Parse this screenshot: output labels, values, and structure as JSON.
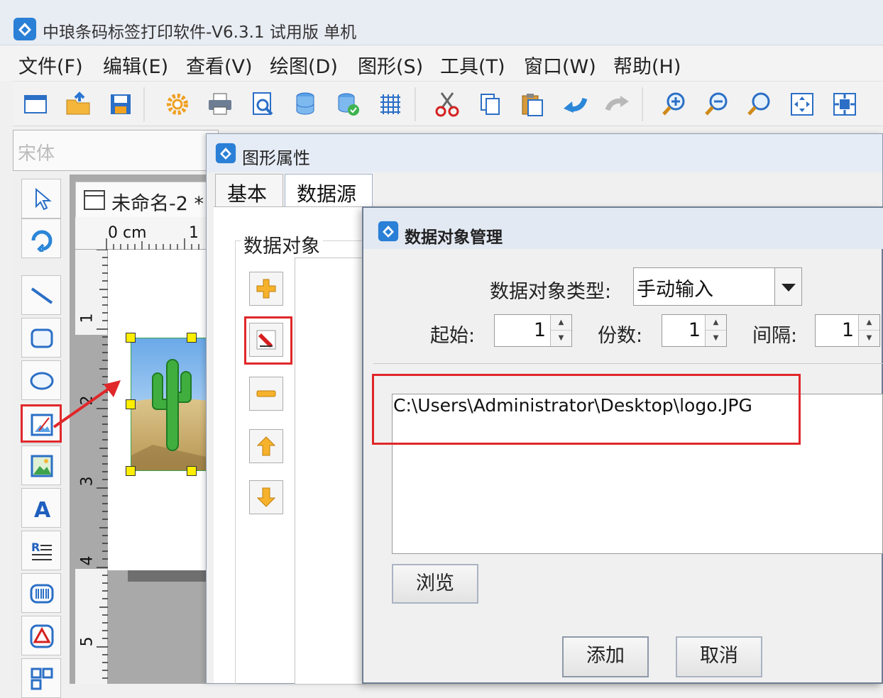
{
  "window": {
    "title": "中琅条码标签打印软件-V6.3.1 试用版 单机"
  },
  "menu": [
    {
      "label": "文件(F)"
    },
    {
      "label": "编辑(E)"
    },
    {
      "label": "查看(V)"
    },
    {
      "label": "绘图(D)"
    },
    {
      "label": "图形(S)"
    },
    {
      "label": "工具(T)"
    },
    {
      "label": "窗口(W)"
    },
    {
      "label": "帮助(H)"
    }
  ],
  "toolbar": {
    "icons": [
      "new-icon",
      "open-icon",
      "save-icon",
      "settings-icon",
      "print-icon",
      "print-preview-icon",
      "database-icon",
      "database-settings-icon",
      "grid-icon",
      "cut-icon",
      "copy-icon",
      "paste-icon",
      "undo-icon",
      "redo-icon",
      "zoom-in-icon",
      "zoom-out-icon",
      "zoom-fit-icon",
      "fit-page-icon",
      "fit-window-icon"
    ]
  },
  "font_box": {
    "placeholder": "宋体"
  },
  "left_tools": [
    "select-tool",
    "rotate-tool",
    "line-tool",
    "rectangle-tool",
    "ellipse-tool",
    "image-tool",
    "picture-tool",
    "text-tool",
    "rich-text-tool",
    "barcode-tool",
    "shape-tool",
    "qrcode-tool"
  ],
  "document": {
    "tab_title": "未命名-2 *",
    "ruler_unit": "0 cm",
    "h_ruler_marks": [
      "1"
    ],
    "v_ruler_marks": [
      "1",
      "2",
      "3",
      "4",
      "5"
    ]
  },
  "property_dialog": {
    "title": "图形属性",
    "tabs": [
      {
        "label": "基本"
      },
      {
        "label": "数据源"
      }
    ],
    "group_label": "数据对象"
  },
  "data_dialog": {
    "title": "数据对象管理",
    "type_label": "数据对象类型:",
    "type_value": "手动输入",
    "start_label": "起始:",
    "start_value": "1",
    "copies_label": "份数:",
    "copies_value": "1",
    "interval_label": "间隔:",
    "interval_value": "1",
    "path_value": "C:\\Users\\Administrator\\Desktop\\logo.JPG",
    "browse_label": "浏览",
    "add_label": "添加",
    "cancel_label": "取消"
  },
  "colors": {
    "highlight": "#e0272a",
    "accent": "#2a6fc9"
  }
}
